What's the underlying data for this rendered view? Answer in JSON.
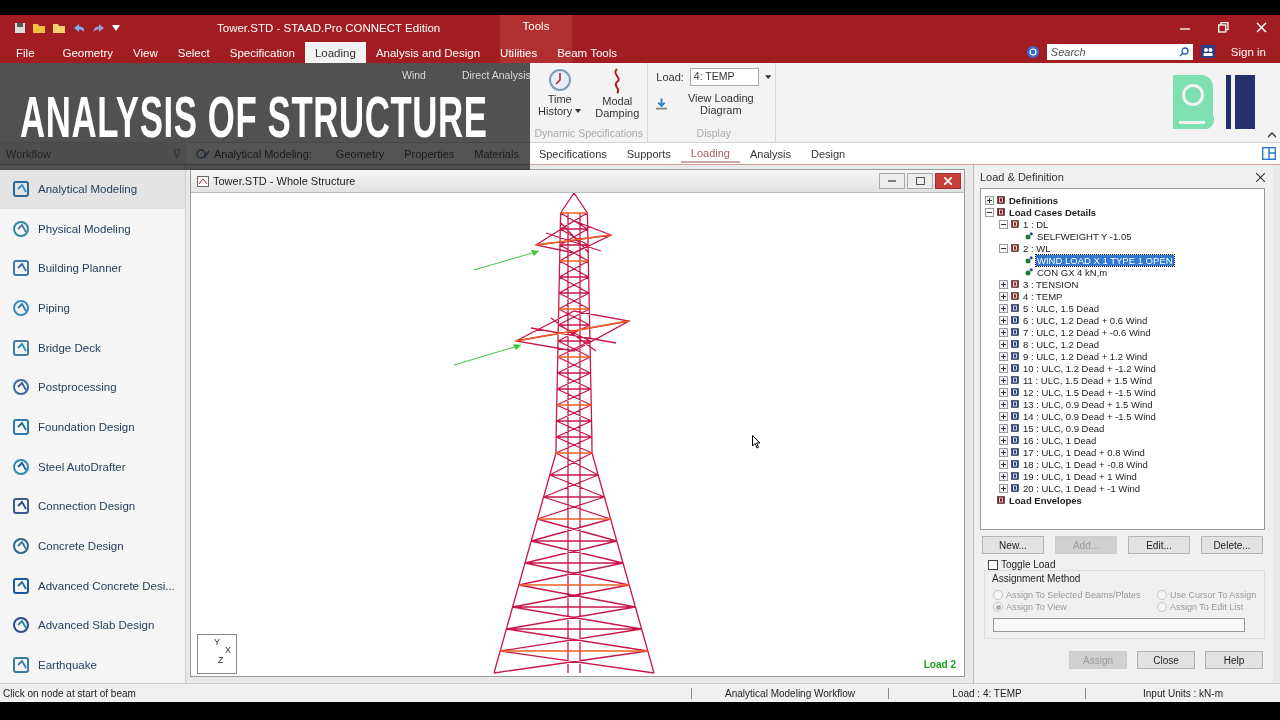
{
  "window": {
    "title": "Tower.STD - STAAD.Pro CONNECT Edition",
    "context_tab": "Tools"
  },
  "overlay_title": "ANALYSIS OF STRUCTURE",
  "menu_tabs": [
    {
      "label": "File",
      "selected": false
    },
    {
      "label": "Geometry",
      "selected": false
    },
    {
      "label": "View",
      "selected": false
    },
    {
      "label": "Select",
      "selected": false
    },
    {
      "label": "Specification",
      "selected": false
    },
    {
      "label": "Loading",
      "selected": true
    },
    {
      "label": "Analysis and Design",
      "selected": false
    },
    {
      "label": "Utilities",
      "selected": false
    },
    {
      "label": "Beam Tools",
      "selected": false
    }
  ],
  "search": {
    "placeholder": "Search"
  },
  "sign_in": "Sign in",
  "ribbon": {
    "dimmed_labels": [
      "Wind",
      "Direct Analysis"
    ],
    "dynamic_group": {
      "buttons": [
        {
          "label": "Time History",
          "dropdown": true
        },
        {
          "label": "Modal Damping",
          "dropdown": false
        }
      ],
      "caption": "Dynamic Specifications"
    },
    "display_group": {
      "load_label": "Load:",
      "load_value": "4: TEMP",
      "link": "View Loading Diagram",
      "caption": "Display"
    }
  },
  "workflow_header": "Workflow",
  "workflow_label": "Analytical Modeling:",
  "workflow_tabs": [
    {
      "label": "Geometry",
      "selected": false
    },
    {
      "label": "Properties",
      "selected": false
    },
    {
      "label": "Materials",
      "selected": false
    },
    {
      "label": "Specifications",
      "selected": false
    },
    {
      "label": "Supports",
      "selected": false
    },
    {
      "label": "Loading",
      "selected": true
    },
    {
      "label": "Analysis",
      "selected": false
    },
    {
      "label": "Design",
      "selected": false
    }
  ],
  "sidebar": {
    "items": [
      {
        "label": "Analytical Modeling",
        "selected": true
      },
      {
        "label": "Physical Modeling",
        "selected": false
      },
      {
        "label": "Building Planner",
        "selected": false
      },
      {
        "label": "Piping",
        "selected": false
      },
      {
        "label": "Bridge Deck",
        "selected": false
      },
      {
        "label": "Postprocessing",
        "selected": false
      },
      {
        "label": "Foundation Design",
        "selected": false
      },
      {
        "label": "Steel AutoDrafter",
        "selected": false
      },
      {
        "label": "Connection Design",
        "selected": false
      },
      {
        "label": "Concrete Design",
        "selected": false
      },
      {
        "label": "Advanced Concrete Desi...",
        "selected": false
      },
      {
        "label": "Advanced Slab Design",
        "selected": false
      },
      {
        "label": "Earthquake",
        "selected": false
      }
    ]
  },
  "viewport": {
    "title": "Tower.STD - Whole Structure",
    "triad": [
      "Y",
      "X",
      "Z"
    ],
    "load_label": "Load 2"
  },
  "load_panel": {
    "title": "Load & Definition",
    "tree": [
      {
        "label": "Definitions",
        "kind": "definitions",
        "expanded": false,
        "selected": false
      },
      {
        "label": "Load Cases Details",
        "kind": "definitions",
        "expanded": true,
        "selected": false,
        "children": [
          {
            "label": "1 : DL",
            "kind": "load-case",
            "expanded": true,
            "selected": false,
            "children": [
              {
                "label": "SELFWEIGHT Y -1.05",
                "kind": "load-item",
                "selected": false
              }
            ]
          },
          {
            "label": "2 : WL",
            "kind": "load-case",
            "expanded": true,
            "selected": false,
            "children": [
              {
                "label": "WIND LOAD X 1 TYPE 1 OPEN",
                "kind": "load-item",
                "selected": true
              },
              {
                "label": "CON GX 4 kN,m",
                "kind": "load-item",
                "selected": false
              }
            ]
          },
          {
            "label": "3 : TENSION",
            "kind": "load-case",
            "expanded": false,
            "selected": false
          },
          {
            "label": "4 : TEMP",
            "kind": "load-case",
            "expanded": false,
            "selected": false
          },
          {
            "label": "5 : ULC, 1.5 Dead",
            "kind": "combination",
            "expanded": false,
            "selected": false
          },
          {
            "label": "6 : ULC, 1.2 Dead + 0.6 Wind",
            "kind": "combination",
            "expanded": false,
            "selected": false
          },
          {
            "label": "7 : ULC, 1.2 Dead + -0.6 Wind",
            "kind": "combination",
            "expanded": false,
            "selected": false
          },
          {
            "label": "8 : ULC, 1.2 Dead",
            "kind": "combination",
            "expanded": false,
            "selected": false
          },
          {
            "label": "9 : ULC, 1.2 Dead + 1.2 Wind",
            "kind": "combination",
            "expanded": false,
            "selected": false
          },
          {
            "label": "10 : ULC, 1.2 Dead + -1.2 Wind",
            "kind": "combination",
            "expanded": false,
            "selected": false
          },
          {
            "label": "11 : ULC, 1.5 Dead + 1.5 Wind",
            "kind": "combination",
            "expanded": false,
            "selected": false
          },
          {
            "label": "12 : ULC, 1.5 Dead + -1.5 Wind",
            "kind": "combination",
            "expanded": false,
            "selected": false
          },
          {
            "label": "13 : ULC, 0.9 Dead + 1.5 Wind",
            "kind": "combination",
            "expanded": false,
            "selected": false
          },
          {
            "label": "14 : ULC, 0.9 Dead + -1.5 Wind",
            "kind": "combination",
            "expanded": false,
            "selected": false
          },
          {
            "label": "15 : ULC, 0.9 Dead",
            "kind": "combination",
            "expanded": false,
            "selected": false
          },
          {
            "label": "16 : ULC, 1 Dead",
            "kind": "combination",
            "expanded": false,
            "selected": false
          },
          {
            "label": "17 : ULC, 1 Dead + 0.8 Wind",
            "kind": "combination",
            "expanded": false,
            "selected": false
          },
          {
            "label": "18 : ULC, 1 Dead + -0.8 Wind",
            "kind": "combination",
            "expanded": false,
            "selected": false
          },
          {
            "label": "19 : ULC, 1 Dead + 1 Wind",
            "kind": "combination",
            "expanded": false,
            "selected": false
          },
          {
            "label": "20 : ULC, 1 Dead + -1 Wind",
            "kind": "combination",
            "expanded": false,
            "selected": false
          }
        ]
      },
      {
        "label": "Load Envelopes",
        "kind": "definitions",
        "selected": false
      }
    ],
    "buttons": [
      {
        "label": "New...",
        "disabled": false
      },
      {
        "label": "Add...",
        "disabled": true
      },
      {
        "label": "Edit...",
        "disabled": false
      },
      {
        "label": "Delete...",
        "disabled": false
      }
    ],
    "toggle_load": {
      "label": "Toggle Load",
      "checked": false
    },
    "assignment": {
      "title": "Assignment Method",
      "options": [
        {
          "label": "Assign To Selected Beams/Plates",
          "selected": false,
          "disabled": true
        },
        {
          "label": "Use Cursor To Assign",
          "selected": false,
          "disabled": true
        },
        {
          "label": "Assign To View",
          "selected": true,
          "disabled": true
        },
        {
          "label": "Assign To Edit List",
          "selected": false,
          "disabled": true
        }
      ]
    },
    "footer_buttons": [
      {
        "label": "Assign",
        "disabled": true
      },
      {
        "label": "Close",
        "disabled": false
      },
      {
        "label": "Help",
        "disabled": false
      }
    ]
  },
  "status_bar": [
    "Click on node at start of beam",
    "Analytical Modeling Workflow",
    "Load : 4: TEMP",
    "Input Units : kN-m"
  ]
}
